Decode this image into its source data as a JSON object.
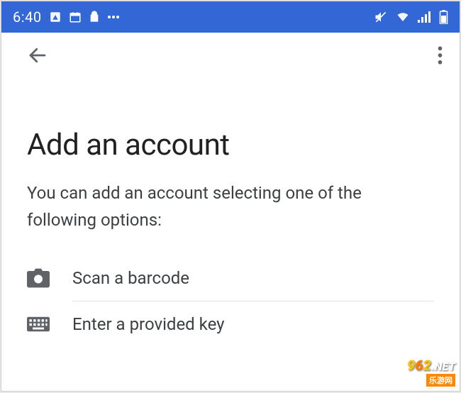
{
  "statusbar": {
    "time": "6:40"
  },
  "page": {
    "title": "Add an account",
    "subtitle": "You can add an account selecting one of the following options:"
  },
  "options": {
    "scan": {
      "label": "Scan a barcode"
    },
    "enter": {
      "label": "Enter a provided key"
    }
  },
  "watermark": {
    "line1_a": "962",
    "line1_b": ".NET",
    "line2": "乐游网"
  }
}
